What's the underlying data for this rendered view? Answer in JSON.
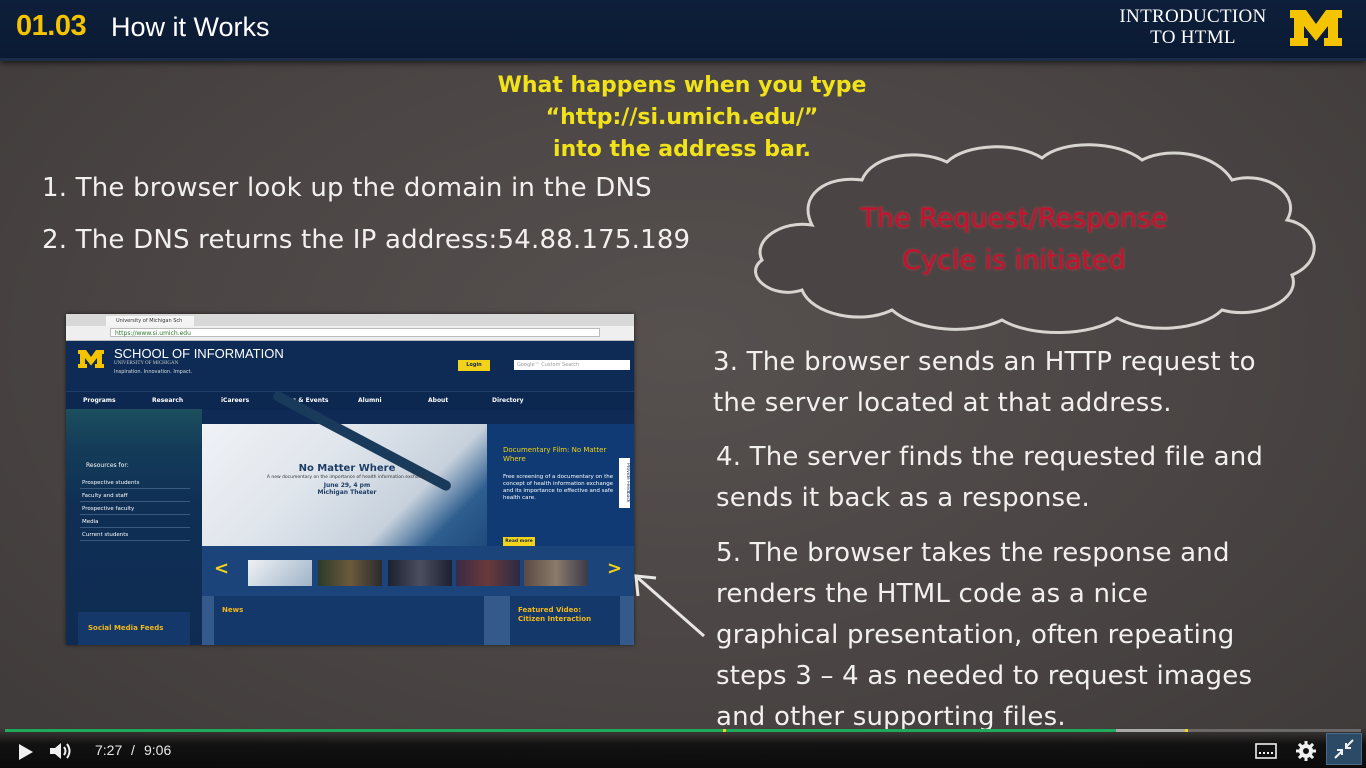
{
  "header": {
    "lesson_number": "01.03",
    "lesson_title": "How it Works",
    "course_line1": "INTRODUCTION",
    "course_line2": "TO HTML",
    "logo_letter": "M"
  },
  "headline": {
    "line1": "What happens when you type",
    "line2": "“http://si.umich.edu/”",
    "line3": "into the address bar."
  },
  "steps": {
    "s1": "1. The browser look up the domain in the DNS",
    "s2": "2.  The DNS returns the IP address:54.88.175.189",
    "s3_l1": "3. The browser sends an HTTP request to",
    "s3_l2": "the server located at that address.",
    "s4_l1": "4. The server finds the requested file and",
    "s4_l2": "sends it back as a response.",
    "s5_l1": "5. The browser takes the response and",
    "s5_l2": "renders the HTML code as a nice",
    "s5_l3": "graphical presentation, often repeating",
    "s5_l4": "steps 3 – 4 as needed to request images",
    "s5_l5": "and other supporting files."
  },
  "cloud": {
    "line1": "The Request/Response",
    "line2": "Cycle is initiated"
  },
  "website": {
    "tab_title": "University of Michigan Sch",
    "url": "https://www.si.umich.edu",
    "school_name": "SCHOOL OF INFORMATION",
    "university": "UNIVERSITY OF MICHIGAN",
    "tagline": "Inspiration. Innovation. Impact.",
    "login": "Login",
    "search_placeholder": "Google™ Custom Search",
    "nav": [
      "Programs",
      "Research",
      "iCareers",
      "News & Events",
      "Alumni",
      "About",
      "Directory"
    ],
    "resources_title": "Resources for:",
    "resources": [
      "Prospective students",
      "Faculty and staff",
      "Prospective faculty",
      "Media",
      "Current students"
    ],
    "hero_title": "No Matter Where",
    "hero_sub": "A new documentary on the importance of health information exchange",
    "hero_date1": "June 29, 4 pm",
    "hero_date2": "Michigan Theater",
    "feature_title": "Documentary Film: No Matter Where",
    "feature_body": "Free screening of a documentary on the concept of health information exchange and its importance to effective and safe health care.",
    "read_more": "Read more",
    "feedback": "Provide Feedback",
    "social_title": "Social Media Feeds",
    "news_title": "News",
    "video_title": "Featured Video: Citizen Interaction"
  },
  "player": {
    "current_time": "7:27",
    "separator": "/",
    "total_time": "9:06",
    "progress_fraction": 0.819,
    "played_color": "#1fa95a"
  },
  "colors": {
    "header_bg": "#0e1f3b",
    "accent_gold": "#f5c400",
    "headline_yellow": "#f2e21a",
    "cloud_text_red": "#c8102e"
  }
}
